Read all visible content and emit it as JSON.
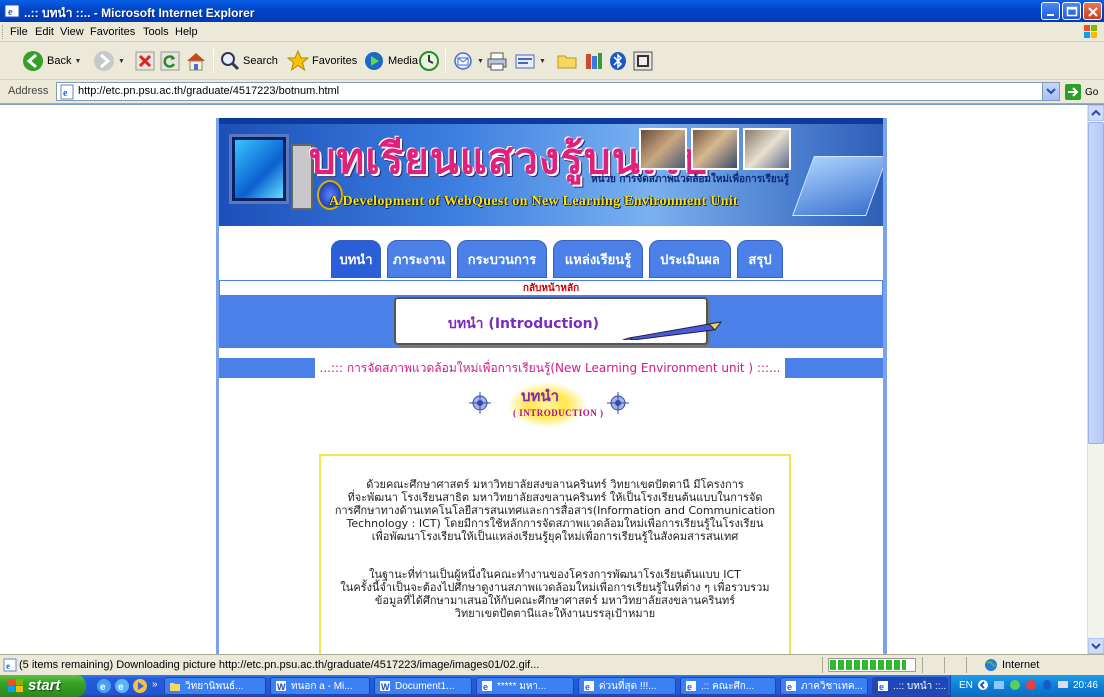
{
  "window": {
    "title": "..:: บทนำ ::.. - Microsoft Internet Explorer"
  },
  "menu": [
    "File",
    "Edit",
    "View",
    "Favorites",
    "Tools",
    "Help"
  ],
  "toolbar": {
    "back_label": "Back",
    "search_label": "Search",
    "favorites_label": "Favorites",
    "media_label": "Media"
  },
  "address": {
    "label": "Address",
    "url": "http://etc.pn.psu.ac.th/graduate/4517223/botnum.html",
    "go_label": "Go"
  },
  "page": {
    "banner": {
      "title": "บทเรียนแสวงรู้บนเว็บ",
      "unit_line": "หน่วย การจัดสภาพแวดล้อมใหม่เพื่อการเรียนรู้",
      "subtitle": "A Development of WebQuest on New Learning Environment Unit"
    },
    "tabs": [
      "บทนำ",
      "ภาระงาน",
      "กระบวนการ",
      "แหล่งเรียนรู้",
      "ประเมินผล",
      "สรุป"
    ],
    "home_link": "กลับหน้าหลัก",
    "intro_heading": "บทนำ (Introduction)",
    "unit_title": "...::: การจัดสภาพแวดล้อมใหม่เพื่อการเรียนรู้(New Learning Environment unit ) :::...",
    "intro_logo": {
      "thai": "บทนำ",
      "english": "( INTRODUCTION )"
    },
    "paragraph1": [
      "ด้วยคณะศึกษาศาสตร์  มหาวิทยาลัยสงขลานครินทร์  วิทยาเขตปัตตานี  มีโครงการ",
      "ที่จะพัฒนา  โรงเรียนสาธิต  มหาวิทยาลัยสงขลานครินทร์  ให้เป็นโรงเรียนต้นแบบในการจัด",
      "การศึกษาทางด้านเทคโนโลยีสารสนเทศและการสื่อสาร(Information  and Communication",
      "Technology : ICT) โดยมีการใช้หลักการจัดสภาพแวดล้อมใหม่เพื่อการเรียนรู้ในโรงเรียน",
      "เพื่อพัฒนาโรงเรียนให้เป็นแหล่งเรียนรู้ยุคใหม่เพื่อการเรียนรู้ในสังคมสารสนเทศ"
    ],
    "paragraph2": [
      "ในฐานะที่ท่านเป็นผู้หนึ่งในคณะทำงานของโครงการพัฒนาโรงเรียนต้นแบบ ICT",
      "ในครั้งนี้จำเป็นจะต้องไปศึกษาดูงานสภาพแวดล้อมใหม่เพื่อการเรียนรู้ในที่ต่าง ๆ เพื่อรวบรวม",
      "ข้อมูลที่ได้ศึกษามาเสนอให้กับคณะศึกษาศาสตร์  มหาวิทยาลัยสงขลานครินทร์",
      "วิทยาเขตปัตตานีและให้งานบรรลุเป้าหมาย"
    ]
  },
  "status": {
    "text": "(5 items remaining) Downloading picture http://etc.pn.psu.ac.th/graduate/4517223/image/images01/02.gif...",
    "progress": 0.9,
    "zone": "Internet"
  },
  "taskbar": {
    "start_label": "start",
    "tasks": [
      "วิทยานิพนธ์...",
      "ทนอก a - Mi...",
      "Document1...",
      "***** มหา...",
      "ด่วนที่สุด !!!...",
      ".:: คณะศึก...",
      "ภาควิชาเทค...",
      "..:: บทนำ ::..."
    ],
    "lang": "EN",
    "clock": "20:46"
  },
  "colors": {
    "accent": "#4a80e8",
    "title_bar": "#0047c8",
    "taskbar": "#245edb",
    "start": "#36a024"
  }
}
